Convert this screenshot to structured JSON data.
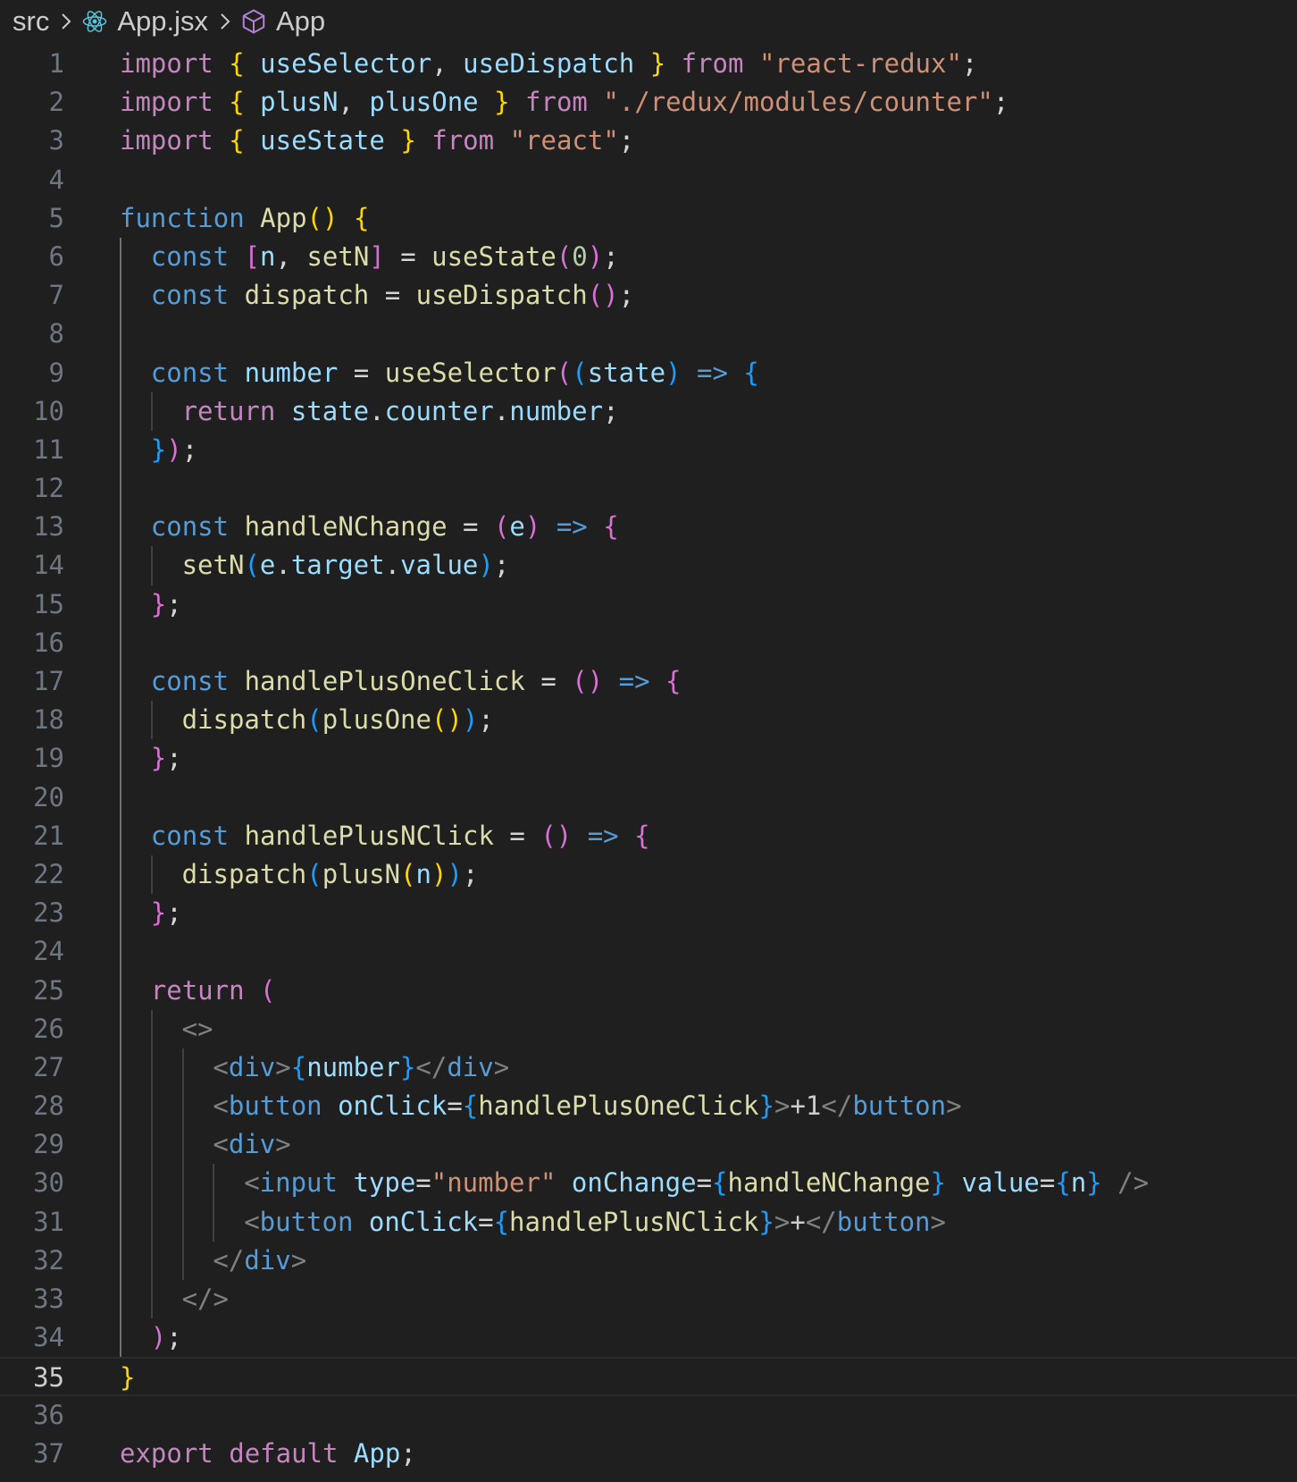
{
  "breadcrumb": {
    "items": [
      {
        "label": "src",
        "icon": "none"
      },
      {
        "label": "App.jsx",
        "icon": "react-icon"
      },
      {
        "label": "App",
        "icon": "symbol-cube-icon"
      }
    ]
  },
  "editor": {
    "language": "javascriptreact",
    "current_line": 35,
    "colors": {
      "background": "#1f1f1f",
      "line_number": "#6e7681",
      "current_line_number": "#cccccc",
      "keyword_control": "#c586c0",
      "keyword_storage": "#569cd6",
      "string": "#ce9178",
      "function": "#dcdcaa",
      "variable": "#9cdcfe",
      "bracket_level_1": "#ffd700",
      "bracket_level_2": "#da70d6",
      "bracket_level_3": "#179fff"
    },
    "lines": [
      {
        "num": "1",
        "tokens": [
          [
            "import",
            "kw"
          ],
          [
            " ",
            "pl"
          ],
          [
            "{",
            "b1"
          ],
          [
            " ",
            "pl"
          ],
          [
            "useSelector",
            "var"
          ],
          [
            ", ",
            "pl"
          ],
          [
            "useDispatch",
            "var"
          ],
          [
            " ",
            "pl"
          ],
          [
            "}",
            "b1"
          ],
          [
            " ",
            "pl"
          ],
          [
            "from",
            "kw"
          ],
          [
            " ",
            "pl"
          ],
          [
            "\"react-redux\"",
            "str"
          ],
          [
            ";",
            "pl"
          ]
        ]
      },
      {
        "num": "2",
        "tokens": [
          [
            "import",
            "kw"
          ],
          [
            " ",
            "pl"
          ],
          [
            "{",
            "b1"
          ],
          [
            " ",
            "pl"
          ],
          [
            "plusN",
            "var"
          ],
          [
            ", ",
            "pl"
          ],
          [
            "plusOne",
            "var"
          ],
          [
            " ",
            "pl"
          ],
          [
            "}",
            "b1"
          ],
          [
            " ",
            "pl"
          ],
          [
            "from",
            "kw"
          ],
          [
            " ",
            "pl"
          ],
          [
            "\"./redux/modules/counter\"",
            "str"
          ],
          [
            ";",
            "pl"
          ]
        ]
      },
      {
        "num": "3",
        "tokens": [
          [
            "import",
            "kw"
          ],
          [
            " ",
            "pl"
          ],
          [
            "{",
            "b1"
          ],
          [
            " ",
            "pl"
          ],
          [
            "useState",
            "var"
          ],
          [
            " ",
            "pl"
          ],
          [
            "}",
            "b1"
          ],
          [
            " ",
            "pl"
          ],
          [
            "from",
            "kw"
          ],
          [
            " ",
            "pl"
          ],
          [
            "\"react\"",
            "str"
          ],
          [
            ";",
            "pl"
          ]
        ]
      },
      {
        "num": "4",
        "tokens": []
      },
      {
        "num": "5",
        "tokens": [
          [
            "function",
            "st"
          ],
          [
            " ",
            "pl"
          ],
          [
            "App",
            "fn"
          ],
          [
            "()",
            "b1"
          ],
          [
            " ",
            "pl"
          ],
          [
            "{",
            "b1"
          ]
        ]
      },
      {
        "num": "6",
        "tokens": [
          [
            "const",
            "st"
          ],
          [
            " ",
            "pl"
          ],
          [
            "[",
            "b2"
          ],
          [
            "n",
            "var"
          ],
          [
            ", ",
            "pl"
          ],
          [
            "setN",
            "fn"
          ],
          [
            "]",
            "b2"
          ],
          [
            " = ",
            "pl"
          ],
          [
            "useState",
            "fn"
          ],
          [
            "(",
            "b2"
          ],
          [
            "0",
            "num"
          ],
          [
            ")",
            "b2"
          ],
          [
            ";",
            "pl"
          ]
        ]
      },
      {
        "num": "7",
        "tokens": [
          [
            "const",
            "st"
          ],
          [
            " ",
            "pl"
          ],
          [
            "dispatch",
            "fn"
          ],
          [
            " = ",
            "pl"
          ],
          [
            "useDispatch",
            "fn"
          ],
          [
            "()",
            "b2"
          ],
          [
            ";",
            "pl"
          ]
        ]
      },
      {
        "num": "8",
        "tokens": []
      },
      {
        "num": "9",
        "tokens": [
          [
            "const",
            "st"
          ],
          [
            " ",
            "pl"
          ],
          [
            "number",
            "var"
          ],
          [
            " = ",
            "pl"
          ],
          [
            "useSelector",
            "fn"
          ],
          [
            "(",
            "b2"
          ],
          [
            "(",
            "b3"
          ],
          [
            "state",
            "var"
          ],
          [
            ")",
            "b3"
          ],
          [
            " ",
            "pl"
          ],
          [
            "=>",
            "st"
          ],
          [
            " ",
            "pl"
          ],
          [
            "{",
            "b3"
          ]
        ]
      },
      {
        "num": "10",
        "tokens": [
          [
            "return",
            "kw"
          ],
          [
            " ",
            "pl"
          ],
          [
            "state",
            "var"
          ],
          [
            ".",
            "pl"
          ],
          [
            "counter",
            "var"
          ],
          [
            ".",
            "pl"
          ],
          [
            "number",
            "var"
          ],
          [
            ";",
            "pl"
          ]
        ]
      },
      {
        "num": "11",
        "tokens": [
          [
            "}",
            "b3"
          ],
          [
            ")",
            "b2"
          ],
          [
            ";",
            "pl"
          ]
        ]
      },
      {
        "num": "12",
        "tokens": []
      },
      {
        "num": "13",
        "tokens": [
          [
            "const",
            "st"
          ],
          [
            " ",
            "pl"
          ],
          [
            "handleNChange",
            "fn"
          ],
          [
            " = ",
            "pl"
          ],
          [
            "(",
            "b2"
          ],
          [
            "e",
            "var"
          ],
          [
            ")",
            "b2"
          ],
          [
            " ",
            "pl"
          ],
          [
            "=>",
            "st"
          ],
          [
            " ",
            "pl"
          ],
          [
            "{",
            "b2"
          ]
        ]
      },
      {
        "num": "14",
        "tokens": [
          [
            "setN",
            "fn"
          ],
          [
            "(",
            "b3"
          ],
          [
            "e",
            "var"
          ],
          [
            ".",
            "pl"
          ],
          [
            "target",
            "var"
          ],
          [
            ".",
            "pl"
          ],
          [
            "value",
            "var"
          ],
          [
            ")",
            "b3"
          ],
          [
            ";",
            "pl"
          ]
        ]
      },
      {
        "num": "15",
        "tokens": [
          [
            "}",
            "b2"
          ],
          [
            ";",
            "pl"
          ]
        ]
      },
      {
        "num": "16",
        "tokens": []
      },
      {
        "num": "17",
        "tokens": [
          [
            "const",
            "st"
          ],
          [
            " ",
            "pl"
          ],
          [
            "handlePlusOneClick",
            "fn"
          ],
          [
            " = ",
            "pl"
          ],
          [
            "()",
            "b2"
          ],
          [
            " ",
            "pl"
          ],
          [
            "=>",
            "st"
          ],
          [
            " ",
            "pl"
          ],
          [
            "{",
            "b2"
          ]
        ]
      },
      {
        "num": "18",
        "tokens": [
          [
            "dispatch",
            "fn"
          ],
          [
            "(",
            "b3"
          ],
          [
            "plusOne",
            "fn"
          ],
          [
            "()",
            "b1"
          ],
          [
            ")",
            "b3"
          ],
          [
            ";",
            "pl"
          ]
        ]
      },
      {
        "num": "19",
        "tokens": [
          [
            "}",
            "b2"
          ],
          [
            ";",
            "pl"
          ]
        ]
      },
      {
        "num": "20",
        "tokens": []
      },
      {
        "num": "21",
        "tokens": [
          [
            "const",
            "st"
          ],
          [
            " ",
            "pl"
          ],
          [
            "handlePlusNClick",
            "fn"
          ],
          [
            " = ",
            "pl"
          ],
          [
            "()",
            "b2"
          ],
          [
            " ",
            "pl"
          ],
          [
            "=>",
            "st"
          ],
          [
            " ",
            "pl"
          ],
          [
            "{",
            "b2"
          ]
        ]
      },
      {
        "num": "22",
        "tokens": [
          [
            "dispatch",
            "fn"
          ],
          [
            "(",
            "b3"
          ],
          [
            "plusN",
            "fn"
          ],
          [
            "(",
            "b1"
          ],
          [
            "n",
            "var"
          ],
          [
            ")",
            "b1"
          ],
          [
            ")",
            "b3"
          ],
          [
            ";",
            "pl"
          ]
        ]
      },
      {
        "num": "23",
        "tokens": [
          [
            "}",
            "b2"
          ],
          [
            ";",
            "pl"
          ]
        ]
      },
      {
        "num": "24",
        "tokens": []
      },
      {
        "num": "25",
        "tokens": [
          [
            "return",
            "kw"
          ],
          [
            " ",
            "pl"
          ],
          [
            "(",
            "b2"
          ]
        ]
      },
      {
        "num": "26",
        "tokens": [
          [
            "<>",
            "br"
          ]
        ]
      },
      {
        "num": "27",
        "tokens": [
          [
            "<",
            "br"
          ],
          [
            "div",
            "tag"
          ],
          [
            ">",
            "br"
          ],
          [
            "{",
            "b3"
          ],
          [
            "number",
            "var"
          ],
          [
            "}",
            "b3"
          ],
          [
            "</",
            "br"
          ],
          [
            "div",
            "tag"
          ],
          [
            ">",
            "br"
          ]
        ]
      },
      {
        "num": "28",
        "tokens": [
          [
            "<",
            "br"
          ],
          [
            "button",
            "tag"
          ],
          [
            " ",
            "pl"
          ],
          [
            "onClick",
            "var"
          ],
          [
            "=",
            "pl"
          ],
          [
            "{",
            "b3"
          ],
          [
            "handlePlusOneClick",
            "fn"
          ],
          [
            "}",
            "b3"
          ],
          [
            ">",
            "br"
          ],
          [
            "+1",
            "pl2"
          ],
          [
            "</",
            "br"
          ],
          [
            "button",
            "tag"
          ],
          [
            ">",
            "br"
          ]
        ]
      },
      {
        "num": "29",
        "tokens": [
          [
            "<",
            "br"
          ],
          [
            "div",
            "tag"
          ],
          [
            ">",
            "br"
          ]
        ]
      },
      {
        "num": "30",
        "tokens": [
          [
            "<",
            "br"
          ],
          [
            "input",
            "tag"
          ],
          [
            " ",
            "pl"
          ],
          [
            "type",
            "var"
          ],
          [
            "=",
            "pl"
          ],
          [
            "\"number\"",
            "str"
          ],
          [
            " ",
            "pl"
          ],
          [
            "onChange",
            "var"
          ],
          [
            "=",
            "pl"
          ],
          [
            "{",
            "b3"
          ],
          [
            "handleNChange",
            "fn"
          ],
          [
            "}",
            "b3"
          ],
          [
            " ",
            "pl"
          ],
          [
            "value",
            "var"
          ],
          [
            "=",
            "pl"
          ],
          [
            "{",
            "b3"
          ],
          [
            "n",
            "var"
          ],
          [
            "}",
            "b3"
          ],
          [
            " ",
            "pl"
          ],
          [
            "/>",
            "br"
          ]
        ]
      },
      {
        "num": "31",
        "tokens": [
          [
            "<",
            "br"
          ],
          [
            "button",
            "tag"
          ],
          [
            " ",
            "pl"
          ],
          [
            "onClick",
            "var"
          ],
          [
            "=",
            "pl"
          ],
          [
            "{",
            "b3"
          ],
          [
            "handlePlusNClick",
            "fn"
          ],
          [
            "}",
            "b3"
          ],
          [
            ">",
            "br"
          ],
          [
            "+",
            "pl2"
          ],
          [
            "</",
            "br"
          ],
          [
            "button",
            "tag"
          ],
          [
            ">",
            "br"
          ]
        ]
      },
      {
        "num": "32",
        "tokens": [
          [
            "</",
            "br"
          ],
          [
            "div",
            "tag"
          ],
          [
            ">",
            "br"
          ]
        ]
      },
      {
        "num": "33",
        "tokens": [
          [
            "</>",
            "br"
          ]
        ]
      },
      {
        "num": "34",
        "tokens": [
          [
            ")",
            "b2"
          ],
          [
            ";",
            "pl"
          ]
        ]
      },
      {
        "num": "35",
        "tokens": [
          [
            "}",
            "b1"
          ]
        ]
      },
      {
        "num": "36",
        "tokens": []
      },
      {
        "num": "37",
        "tokens": [
          [
            "export",
            "kw"
          ],
          [
            " ",
            "pl"
          ],
          [
            "default",
            "kw"
          ],
          [
            " ",
            "pl"
          ],
          [
            "App",
            "var"
          ],
          [
            ";",
            "pl"
          ]
        ]
      }
    ]
  }
}
